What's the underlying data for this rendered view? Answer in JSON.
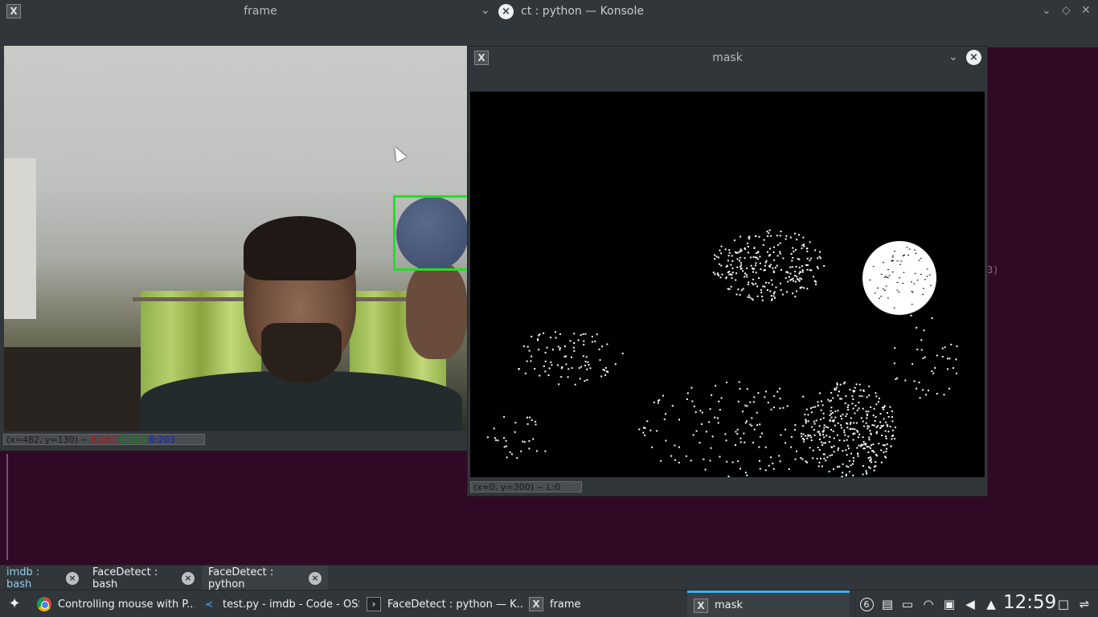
{
  "konsole": {
    "title": "ct : python — Konsole",
    "fragment_text": "3)",
    "tabs": [
      {
        "label": "imdb : bash"
      },
      {
        "label": "FaceDetect : bash"
      },
      {
        "label": "FaceDetect : python"
      }
    ]
  },
  "frame_window": {
    "title": "frame",
    "status": {
      "coords": "(x=482, y=130) ~",
      "r": "R:201",
      "g": "G:203",
      "b": "B:203"
    }
  },
  "mask_window": {
    "title": "mask",
    "status": "(x=0, y=300) ~ L:0"
  },
  "taskbar": {
    "tasks": [
      {
        "label": "Controlling mouse with P...",
        "icon": "chrome-icon"
      },
      {
        "label": "test.py - imdb - Code - OSS",
        "icon": "vscode-icon"
      },
      {
        "label": "FaceDetect : python — K...",
        "icon": "terminal-icon"
      },
      {
        "label": "frame",
        "icon": "x-window-icon"
      },
      {
        "label": "mask",
        "icon": "x-window-icon"
      }
    ],
    "tray": {
      "notifications_count": "6"
    },
    "clock": "12:59"
  },
  "colors": {
    "accent": "#3daee9",
    "bbox": "#22e022",
    "terminal_bg": "#300a24"
  }
}
